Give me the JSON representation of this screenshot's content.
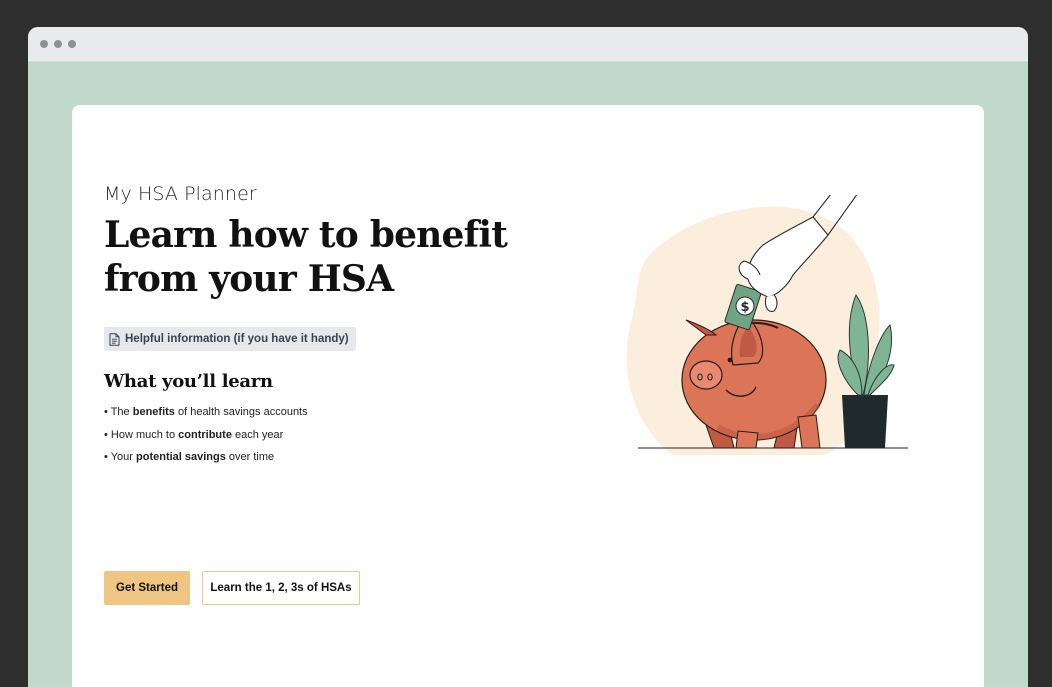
{
  "app": {
    "subtitle": "My HSA Planner",
    "headline": "Learn how to benefit from your HSA"
  },
  "info_chip": {
    "label": "Helpful information (if you have it handy)",
    "icon": "document-icon"
  },
  "learn": {
    "heading": "What you’ll learn",
    "items": [
      {
        "before": "• The ",
        "bold": "benefits",
        "after": " of health savings accounts"
      },
      {
        "before": "• How much to ",
        "bold": "contribute",
        "after": " each year"
      },
      {
        "before": "• Your ",
        "bold": "potential savings",
        "after": " over time"
      }
    ]
  },
  "buttons": {
    "primary": "Get Started",
    "secondary": "Learn the 1, 2, 3s of HSAs"
  },
  "illustration": {
    "name": "piggy-bank-illustration",
    "bill_symbol": "$"
  },
  "colors": {
    "frame": "#2e2e2e",
    "page_background": "#c1d9cd",
    "accent": "#efc584",
    "pig": "#dc7458",
    "blob": "#fbeedc",
    "plant": "#7fb594"
  }
}
